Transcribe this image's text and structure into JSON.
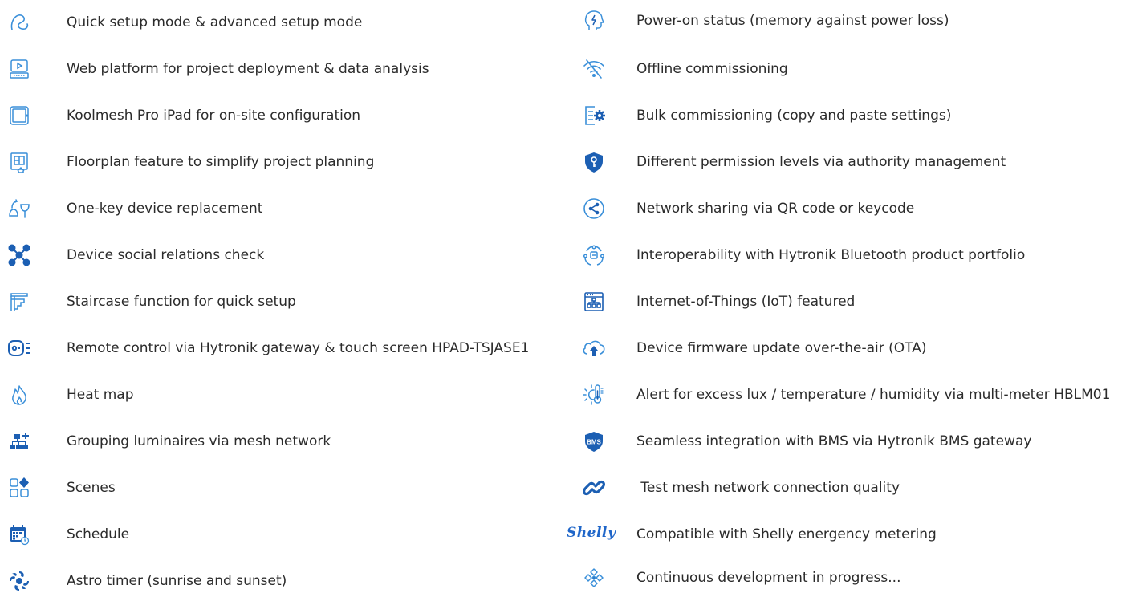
{
  "colors": {
    "icon_blue": "#3a8fd9",
    "icon_dark": "#1c5fb3",
    "text": "#2b2b2b"
  },
  "left_features": [
    {
      "icon": "quick-setup-icon",
      "label": "Quick setup mode & advanced setup mode"
    },
    {
      "icon": "web-platform-icon",
      "label": "Web platform for project deployment & data analysis"
    },
    {
      "icon": "ipad-icon",
      "label": "Koolmesh Pro iPad for on-site configuration"
    },
    {
      "icon": "floorplan-icon",
      "label": "Floorplan feature to simplify project planning"
    },
    {
      "icon": "device-replacement-icon",
      "label": "One-key device replacement"
    },
    {
      "icon": "social-relations-icon",
      "label": "Device social relations check"
    },
    {
      "icon": "staircase-icon",
      "label": "Staircase function for quick setup"
    },
    {
      "icon": "remote-control-icon",
      "label": "Remote control via Hytronik gateway & touch screen HPAD-TSJASE1"
    },
    {
      "icon": "heat-map-icon",
      "label": "Heat map"
    },
    {
      "icon": "grouping-icon",
      "label": "Grouping luminaires via mesh network"
    },
    {
      "icon": "scenes-icon",
      "label": "Scenes"
    },
    {
      "icon": "schedule-icon",
      "label": "Schedule"
    },
    {
      "icon": "astro-timer-icon",
      "label": "Astro timer (sunrise and sunset)"
    }
  ],
  "right_features": [
    {
      "icon": "power-on-status-icon",
      "label": "Power-on status (memory against power loss)"
    },
    {
      "icon": "offline-wifi-icon",
      "label": "Offline commissioning"
    },
    {
      "icon": "bulk-commissioning-icon",
      "label": "Bulk commissioning (copy and paste settings)"
    },
    {
      "icon": "permission-shield-icon",
      "label": "Different permission levels via authority management"
    },
    {
      "icon": "network-share-icon",
      "label": "Network sharing via QR code or keycode"
    },
    {
      "icon": "interoperability-icon",
      "label": "Interoperability with Hytronik Bluetooth product portfolio"
    },
    {
      "icon": "iot-icon",
      "label": "Internet-of-Things (IoT) featured"
    },
    {
      "icon": "cloud-upload-icon",
      "label": "Device firmware update over-the-air (OTA)"
    },
    {
      "icon": "sun-thermometer-icon",
      "label": "Alert for excess lux / temperature / humidity via multi-meter HBLM01"
    },
    {
      "icon": "bms-badge-icon",
      "label": "Seamless integration with BMS via Hytronik BMS gateway",
      "badge": "BMS"
    },
    {
      "icon": "link-icon",
      "label": " Test mesh network connection quality"
    },
    {
      "icon": "shelly-logo",
      "label": "Compatible with Shelly energency metering",
      "logo_text": "Shelly"
    },
    {
      "icon": "development-icon",
      "label": "Continuous development in progress..."
    }
  ]
}
